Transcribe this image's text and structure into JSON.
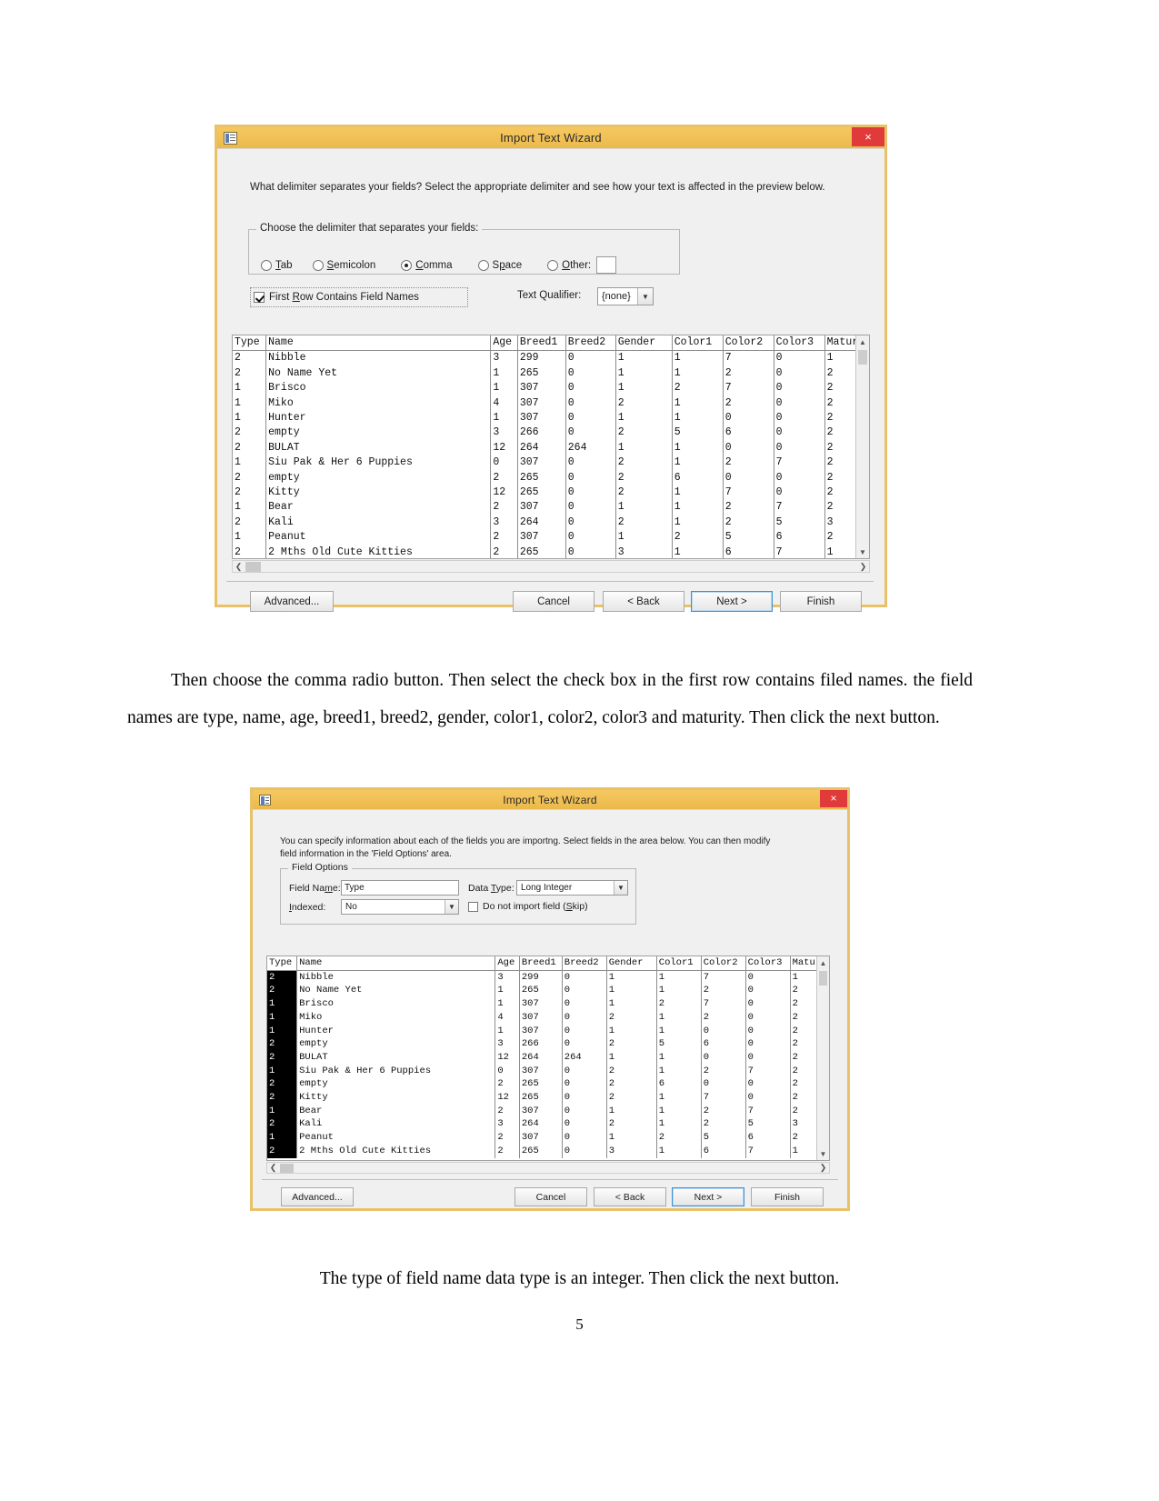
{
  "document": {
    "page_number": "5",
    "paragraph1": "Then choose the comma radio button. Then select the check box in the first row contains filed names. the field names are type, name, age, breed1, breed2, gender, color1, color2, color3 and maturity. Then click the next button.",
    "caption2": "The type of field name data type is an integer. Then click the next button."
  },
  "colors": {
    "title_bar": "#f1c055",
    "dialog_border": "#e8c168",
    "close_button": "#e03a3a",
    "default_button_outline": "#3d8fd6",
    "selected_column": "#000000"
  },
  "dialog1": {
    "title": "Import Text Wizard",
    "close_label": "×",
    "instruction": "What delimiter separates your fields? Select the appropriate delimiter and see how your text is affected in the preview below.",
    "delimiter_group_label": "Choose the delimiter that separates your fields:",
    "delimiters": [
      {
        "label": "Tab",
        "mnemonic": "T",
        "checked": false
      },
      {
        "label": "Semicolon",
        "mnemonic": "S",
        "checked": false
      },
      {
        "label": "Comma",
        "mnemonic": "C",
        "checked": true
      },
      {
        "label": "Space",
        "mnemonic": "p",
        "checked": false
      },
      {
        "label": "Other:",
        "mnemonic": "O",
        "checked": false
      }
    ],
    "other_value": "",
    "first_row_checkbox": {
      "label": "First Row Contains Field Names",
      "checked": true
    },
    "text_qualifier_label": "Text Qualifier:",
    "text_qualifier_value": "{none}",
    "buttons": {
      "advanced": "Advanced...",
      "cancel": "Cancel",
      "back": "< Back",
      "next": "Next >",
      "finish": "Finish"
    }
  },
  "dialog2": {
    "title": "Import Text Wizard",
    "close_label": "×",
    "instruction": "You can specify information about each of the fields you are importng. Select fields in the area below. You can then modify field information in the 'Field Options' area.",
    "field_options_label": "Field Options",
    "field_name_label": "Field Name:",
    "field_name_value": "Type",
    "data_type_label": "Data Type:",
    "data_type_value": "Long Integer",
    "indexed_label": "Indexed:",
    "indexed_value": "No",
    "skip_checkbox": {
      "label": "Do not import field (Skip)",
      "checked": false
    },
    "selected_column_index": 0,
    "buttons": {
      "advanced": "Advanced...",
      "cancel": "Cancel",
      "back": "< Back",
      "next": "Next >",
      "finish": "Finish"
    }
  },
  "preview_table": {
    "columns": [
      "Type",
      "Name",
      "Age",
      "Breed1",
      "Breed2",
      "Gender",
      "Color1",
      "Color2",
      "Color3",
      "Maturi"
    ],
    "rows": [
      [
        "2",
        "Nibble",
        "3",
        "299",
        "0",
        "1",
        "1",
        "7",
        "0",
        "1"
      ],
      [
        "2",
        "No Name Yet",
        "1",
        "265",
        "0",
        "1",
        "1",
        "2",
        "0",
        "2"
      ],
      [
        "1",
        "Brisco",
        "1",
        "307",
        "0",
        "1",
        "2",
        "7",
        "0",
        "2"
      ],
      [
        "1",
        "Miko",
        "4",
        "307",
        "0",
        "2",
        "1",
        "2",
        "0",
        "2"
      ],
      [
        "1",
        "Hunter",
        "1",
        "307",
        "0",
        "1",
        "1",
        "0",
        "0",
        "2"
      ],
      [
        "2",
        "empty",
        "3",
        "266",
        "0",
        "2",
        "5",
        "6",
        "0",
        "2"
      ],
      [
        "2",
        "BULAT",
        "12",
        "264",
        "264",
        "1",
        "1",
        "0",
        "0",
        "2"
      ],
      [
        "1",
        "Siu Pak & Her 6 Puppies",
        "0",
        "307",
        "0",
        "2",
        "1",
        "2",
        "7",
        "2"
      ],
      [
        "2",
        "empty",
        "2",
        "265",
        "0",
        "2",
        "6",
        "0",
        "0",
        "2"
      ],
      [
        "2",
        "Kitty",
        "12",
        "265",
        "0",
        "2",
        "1",
        "7",
        "0",
        "2"
      ],
      [
        "1",
        "Bear",
        "2",
        "307",
        "0",
        "1",
        "1",
        "2",
        "7",
        "2"
      ],
      [
        "2",
        "Kali",
        "3",
        "264",
        "0",
        "2",
        "1",
        "2",
        "5",
        "3"
      ],
      [
        "1",
        "Peanut",
        "2",
        "307",
        "0",
        "1",
        "2",
        "5",
        "6",
        "2"
      ],
      [
        "2",
        "2 Mths Old Cute Kitties",
        "2",
        "265",
        "0",
        "3",
        "1",
        "6",
        "7",
        "1"
      ]
    ]
  }
}
